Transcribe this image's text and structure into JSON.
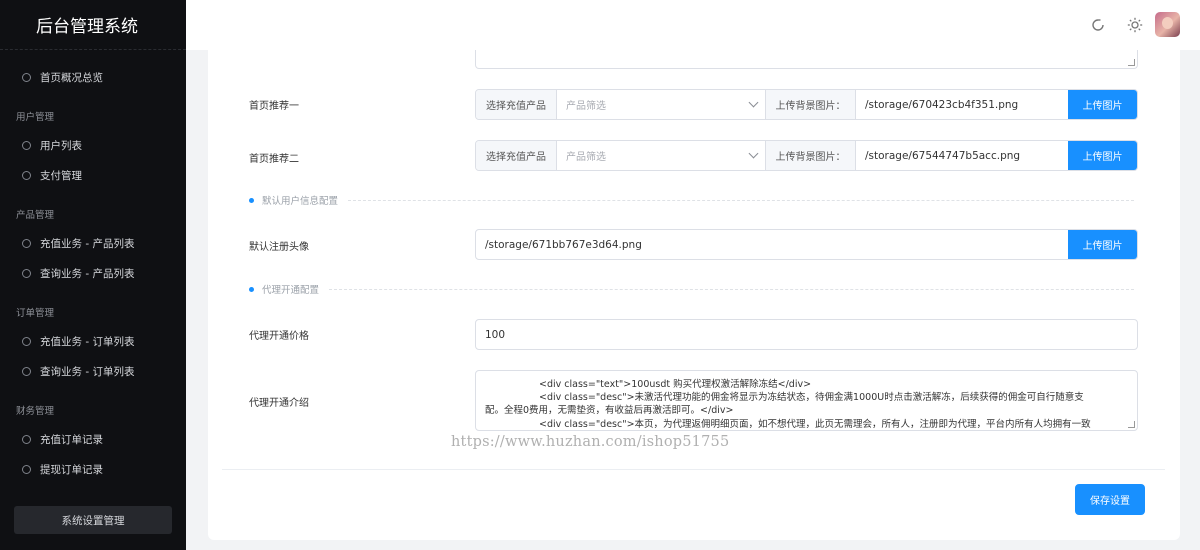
{
  "app": {
    "title": "后台管理系统"
  },
  "sidebar": {
    "home": "首页概况总览",
    "groups": [
      {
        "title": "用户管理",
        "items": [
          "用户列表",
          "支付管理"
        ]
      },
      {
        "title": "产品管理",
        "items": [
          "充值业务 - 产品列表",
          "查询业务 - 产品列表"
        ]
      },
      {
        "title": "订单管理",
        "items": [
          "充值业务 - 订单列表",
          "查询业务 - 订单列表"
        ]
      },
      {
        "title": "财务管理",
        "items": [
          "充值订单记录",
          "提现订单记录"
        ]
      }
    ],
    "system_button": "系统设置管理"
  },
  "header": {
    "icons": [
      "refresh-icon",
      "sun-icon",
      "user-avatar"
    ]
  },
  "form": {
    "recommend1": {
      "label": "首页推荐一",
      "prefix": "选择充值产品",
      "select_placeholder": "产品筛选",
      "bg_label": "上传背景图片：",
      "bg_value": "/storage/670423cb4f351.png",
      "upload": "上传图片"
    },
    "recommend2": {
      "label": "首页推荐二",
      "prefix": "选择充值产品",
      "select_placeholder": "产品筛选",
      "bg_label": "上传背景图片：",
      "bg_value": "/storage/67544747b5acc.png",
      "upload": "上传图片"
    },
    "section_user": "默认用户信息配置",
    "avatar": {
      "label": "默认注册头像",
      "value": "/storage/671bb767e3d64.png",
      "upload": "上传图片"
    },
    "section_agent": "代理开通配置",
    "agent_price": {
      "label": "代理开通价格",
      "value": "100"
    },
    "agent_intro": {
      "label": "代理开通介绍",
      "lines": [
        "<div class=\"text\">100usdt 购买代理权激活解除冻结</div>",
        "<div class=\"desc\">未激活代理功能的佣金将显示为冻结状态，待佣金满1000U时点击激活解冻，后续获得的佣金可自行随意支",
        "配。全程0费用，无需垫资，有收益后再激活即可。</div>",
        "<div class=\"desc\">本页，为代理返佣明细页面，如不想代理，此页无需理会，所有人，注册即为代理，平台内所有人均拥有一致"
      ]
    },
    "save_label": "保存设置"
  },
  "watermark": "https://www.huzhan.com/ishop51755"
}
